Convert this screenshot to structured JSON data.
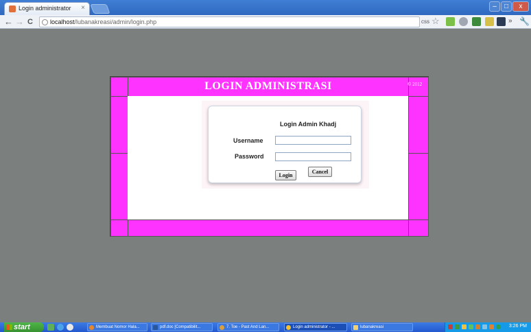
{
  "browser": {
    "tab_title": "Login administrator",
    "tab_close": "×",
    "url_host": "localhost",
    "url_path": "/lubanakreasi/admin/login.php",
    "nav_back": "←",
    "nav_forward": "→",
    "nav_reload": "C",
    "ext_css": "css",
    "star": "☆",
    "more": "»",
    "wrench": "🔧",
    "win_min": "–",
    "win_max": "□",
    "win_close": "x"
  },
  "page": {
    "header_title": "LOGIN ADMINISTRASI",
    "copyright": "© 2012",
    "accent": "#ff33ff"
  },
  "login": {
    "title": "Login Admin Khadj",
    "username_label": "Username",
    "password_label": "Password",
    "username_value": "",
    "password_value": "",
    "login_button": "Login",
    "cancel_button": "Cancel"
  },
  "taskbar": {
    "start": "start",
    "tasks": [
      "Membuat Nomor Hala...",
      "pdf.doc [Compatibilit...",
      "7. Toe - Past And Lan...",
      "Login administrator - ...",
      "lubanakreasi"
    ],
    "clock": "3:26 PM"
  }
}
